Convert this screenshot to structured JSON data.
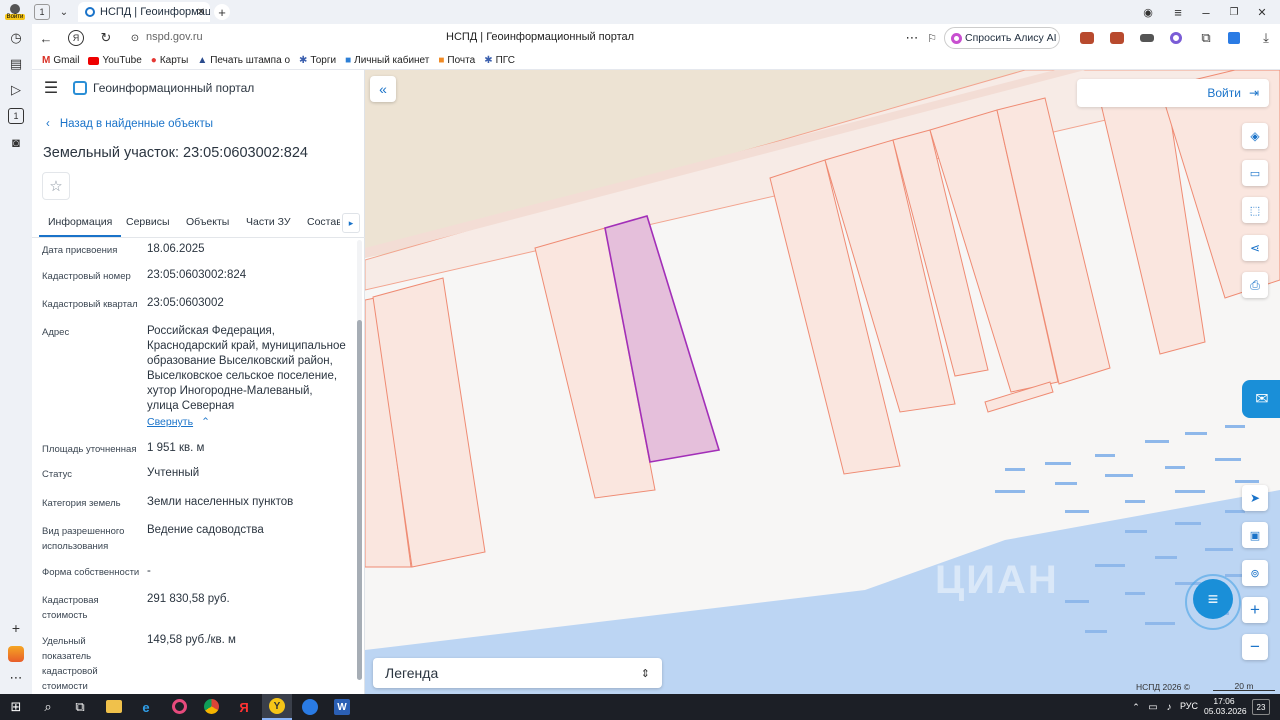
{
  "browser": {
    "profile_label": "Войти",
    "tab_count": "1",
    "tab_title": "НСПД | Геоинформационн",
    "url": "nspd.gov.ru",
    "page_title": "НСПД | Геоинформационный портал",
    "alice_label": "Спросить Алису AI",
    "bookmarks": [
      "Gmail",
      "YouTube",
      "Карты",
      "Печать штампа о",
      "Торги",
      "Личный кабинет",
      "Почта",
      "ПГС"
    ]
  },
  "portal": {
    "title": "Геоинформационный портал",
    "back_link": "Назад в найденные объекты",
    "object_title": "Земельный участок: 23:05:0603002:824",
    "tabs": [
      "Информация",
      "Сервисы",
      "Объекты",
      "Части ЗУ",
      "Состав"
    ],
    "fields": [
      {
        "label": "Дата присвоения",
        "value": "18.06.2025"
      },
      {
        "label": "Кадастровый номер",
        "value": "23:05:0603002:824"
      },
      {
        "label": "Кадастровый квартал",
        "value": "23:05:0603002"
      },
      {
        "label": "Адрес",
        "value": "Российская Федерация, Краснодарский край, муниципальное образование Выселковский район, Выселковское сельское поселение, хутор Иногородне-Малеваный, улица Северная"
      },
      {
        "label": "Площадь уточненная",
        "value": "1 951 кв. м"
      },
      {
        "label": "Статус",
        "value": "Учтенный"
      },
      {
        "label": "Категория земель",
        "value": "Земли населенных пунктов"
      },
      {
        "label": "Вид разрешенного использования",
        "value": "Ведение садоводства"
      },
      {
        "label": "Форма собственности",
        "value": "-"
      },
      {
        "label": "Кадастровая стоимость",
        "value": "291 830,58 руб."
      },
      {
        "label": "Удельный показатель кадастровой стоимости",
        "value": "149,58 руб./кв. м"
      }
    ],
    "collapse_link": "Свернуть"
  },
  "map": {
    "login_label": "Войти",
    "legend_label": "Легенда",
    "copyright": "НСПД 2026 ©",
    "scale_label": "20 m",
    "watermark": "ЦИАН"
  },
  "taskbar": {
    "lang": "РУС",
    "time": "17:06",
    "date": "05.03.2026",
    "notifications": "23"
  }
}
